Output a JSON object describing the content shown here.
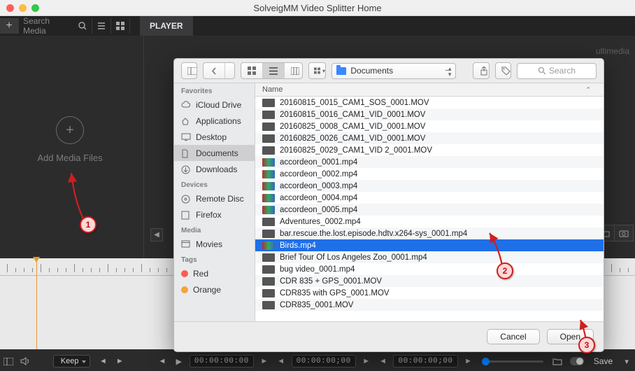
{
  "titlebar": {
    "title": "SolveigMM Video Splitter Home"
  },
  "toolbar": {
    "search_placeholder": "Search Media",
    "player_tab": "PLAYER"
  },
  "right_ghost_label": "ultimedia",
  "addmedia": {
    "label": "Add Media Files",
    "plus": "+"
  },
  "annotations": {
    "n1": "1",
    "n2": "2",
    "n3": "3"
  },
  "bottom": {
    "keep_label": "Keep",
    "tc1": "00:00:00:00",
    "tc2": "00:00:00;00",
    "tc3": "00:00:00;00",
    "save_label": "Save"
  },
  "panel": {
    "location_label": "Documents",
    "search_placeholder": "Search",
    "sidebar": {
      "favorites_head": "Favorites",
      "favorites": [
        "iCloud Drive",
        "Applications",
        "Desktop",
        "Documents",
        "Downloads"
      ],
      "devices_head": "Devices",
      "devices": [
        "Remote Disc",
        "Firefox"
      ],
      "media_head": "Media",
      "media": [
        "Movies"
      ],
      "tags_head": "Tags",
      "tags": [
        {
          "label": "Red",
          "color": "#ff5a52"
        },
        {
          "label": "Orange",
          "color": "#f7a13b"
        }
      ],
      "selected": "Documents"
    },
    "list_header": "Name",
    "files": [
      {
        "name": "20160815_0015_CAM1_SOS_0001.MOV",
        "thumb": "dark"
      },
      {
        "name": "20160815_0016_CAM1_VID_0001.MOV",
        "thumb": "dark"
      },
      {
        "name": "20160825_0008_CAM1_VID_0001.MOV",
        "thumb": "dark"
      },
      {
        "name": "20160825_0026_CAM1_VID_0001.MOV",
        "thumb": "dark"
      },
      {
        "name": "20160825_0029_CAM1_VID 2_0001.MOV",
        "thumb": "dark"
      },
      {
        "name": "accordeon_0001.mp4",
        "thumb": "col"
      },
      {
        "name": "accordeon_0002.mp4",
        "thumb": "col"
      },
      {
        "name": "accordeon_0003.mp4",
        "thumb": "col"
      },
      {
        "name": "accordeon_0004.mp4",
        "thumb": "col"
      },
      {
        "name": "accordeon_0005.mp4",
        "thumb": "col"
      },
      {
        "name": "Adventures_0002.mp4",
        "thumb": "dark"
      },
      {
        "name": "bar.rescue.the.lost.episode.hdtv.x264-sys_0001.mp4",
        "thumb": "dark"
      },
      {
        "name": "Birds.mp4",
        "thumb": "col",
        "selected": true
      },
      {
        "name": "Brief Tour Of Los Angeles Zoo_0001.mp4",
        "thumb": "dark"
      },
      {
        "name": "bug video_0001.mp4",
        "thumb": "dark"
      },
      {
        "name": "CDR 835 + GPS_0001.MOV",
        "thumb": "dark"
      },
      {
        "name": "CDR835 with GPS_0001.MOV",
        "thumb": "dark"
      },
      {
        "name": "CDR835_0001.MOV",
        "thumb": "dark"
      }
    ],
    "cancel_label": "Cancel",
    "open_label": "Open"
  }
}
